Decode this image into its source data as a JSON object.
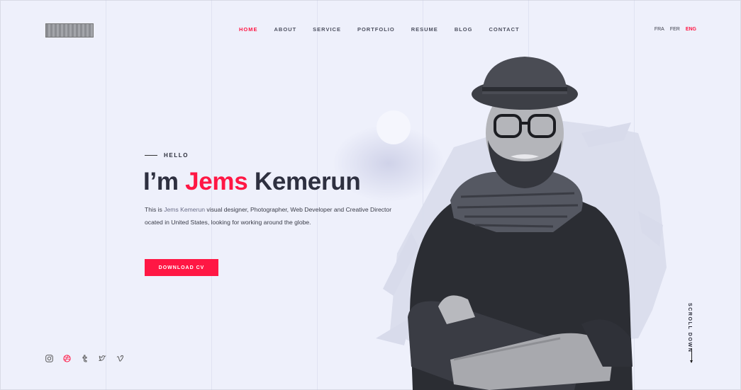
{
  "nav": {
    "items": [
      {
        "label": "HOME",
        "active": true
      },
      {
        "label": "ABOUT",
        "active": false
      },
      {
        "label": "SERVICE",
        "active": false
      },
      {
        "label": "PORTFOLIO",
        "active": false
      },
      {
        "label": "RESUME",
        "active": false
      },
      {
        "label": "BLOG",
        "active": false
      },
      {
        "label": "CONTACT",
        "active": false
      }
    ]
  },
  "languages": [
    {
      "label": "FRA",
      "active": false
    },
    {
      "label": "FER",
      "active": false
    },
    {
      "label": "ENG",
      "active": true
    }
  ],
  "hero": {
    "greeting": "HELLO",
    "name_prefix": "I’m ",
    "name_highlight": "Jems",
    "name_suffix": " Kemerun",
    "intro_line1_start": "This is ",
    "intro_line1_name": "Jems Kemerun",
    "intro_line1_end": " visual designer, Photographer, Web Developer and Creative Director",
    "intro_line2": "ocated in United States, looking for working around the globe.",
    "cta_label": "DOWNLOAD CV"
  },
  "social": [
    "instagram-icon",
    "dribbble-icon",
    "tumblr-icon",
    "twitter-icon",
    "vimeo-icon"
  ],
  "scroll_label": "SCROLL DOWN",
  "colors": {
    "accent": "#ff1744",
    "background": "#eef0fb",
    "text": "#2e3040"
  }
}
